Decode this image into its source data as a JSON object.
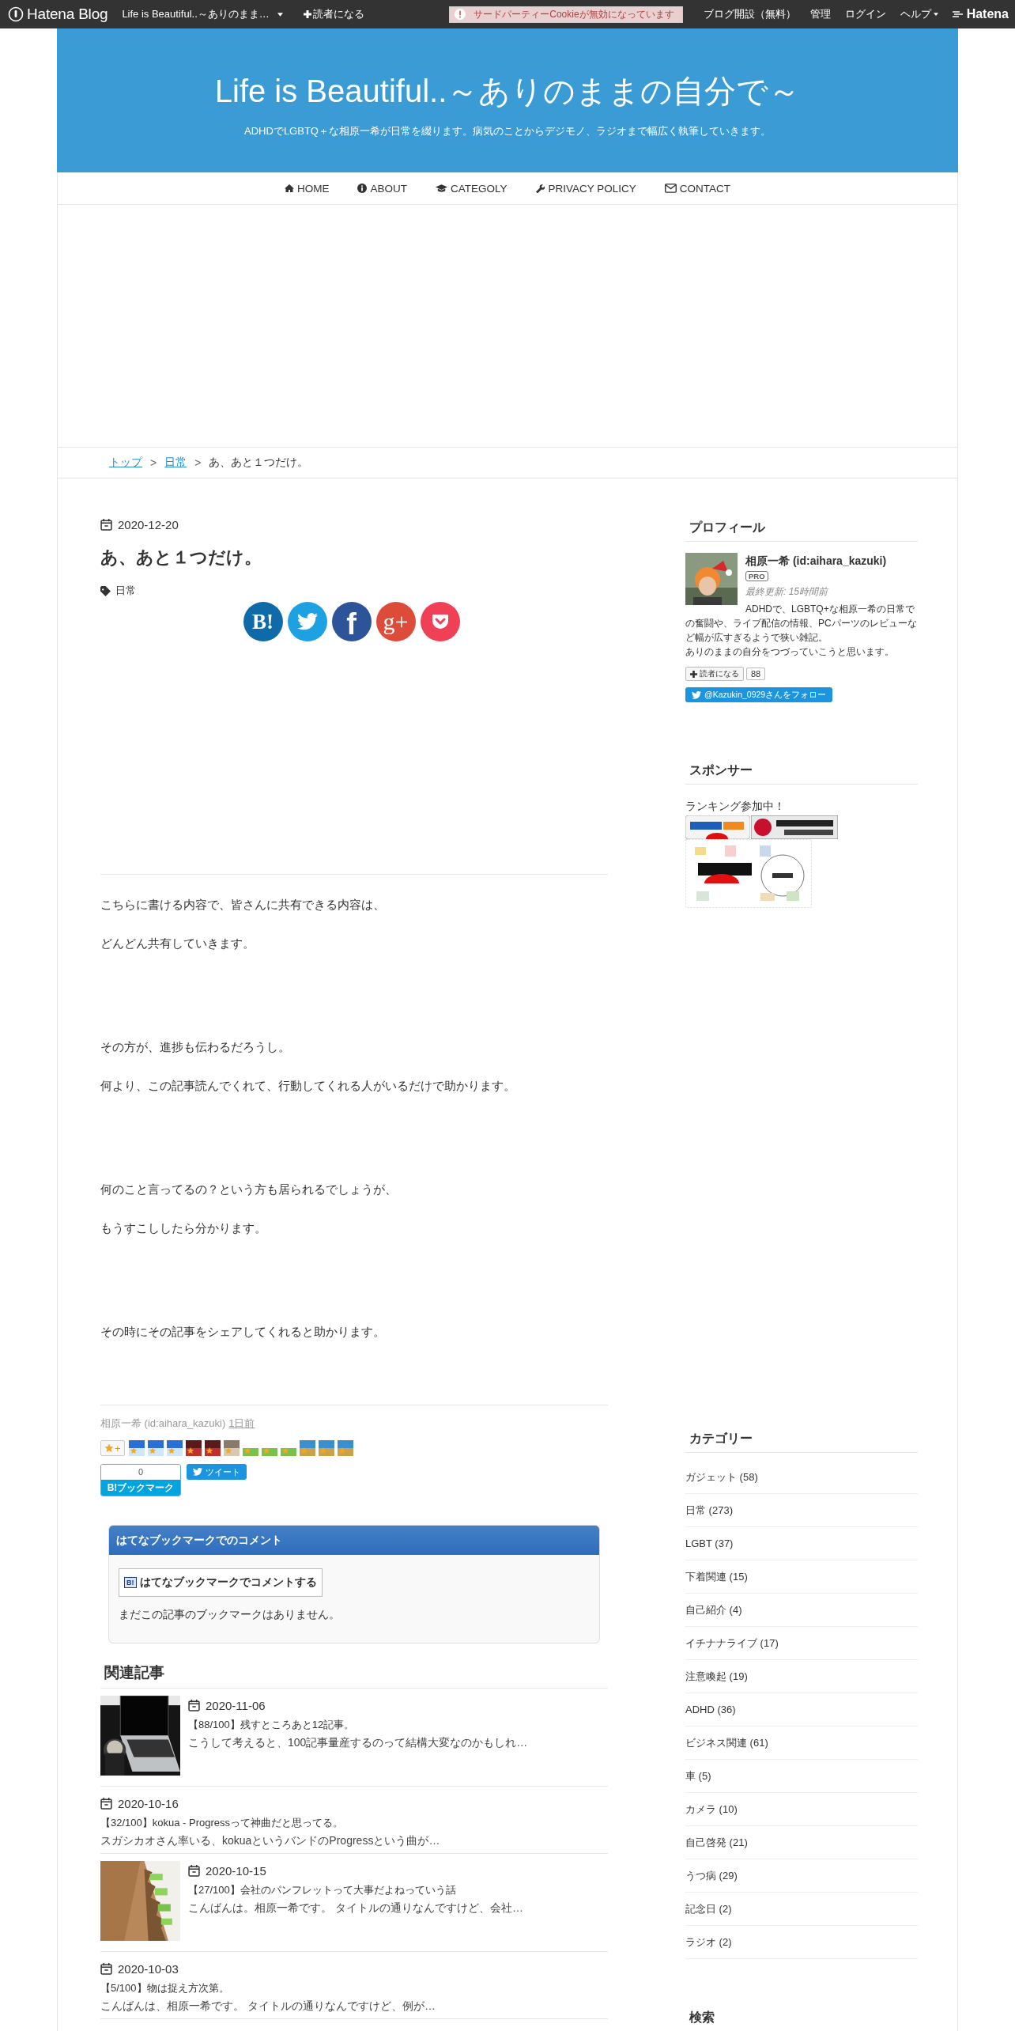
{
  "top_bar": {
    "brand": "Hatena Blog",
    "blog_menu": "Life is Beautiful..～ありのまま…",
    "subscribe": "読者になる",
    "cookie_notice": "サードパーティーCookieが無効になっています",
    "links": [
      {
        "label": "ブログ開設（無料）",
        "dropdown": false
      },
      {
        "label": "管理",
        "dropdown": false
      },
      {
        "label": "ログイン",
        "dropdown": false
      },
      {
        "label": "ヘルプ",
        "dropdown": true
      }
    ],
    "hatena": "Hatena"
  },
  "header": {
    "title": "Life is Beautiful..～ありのままの自分で～",
    "description": "ADHDでLGBTQ＋な相原一希が日常を綴ります。病気のことからデジモノ、ラジオまで幅広く執筆していきます。"
  },
  "nav": [
    {
      "kind": "home",
      "label": "HOME"
    },
    {
      "kind": "info",
      "label": "ABOUT"
    },
    {
      "kind": "cap",
      "label": "CATEGOLY"
    },
    {
      "kind": "wrench",
      "label": "PRIVACY POLICY"
    },
    {
      "kind": "mail",
      "label": "CONTACT"
    }
  ],
  "breadcrumb": {
    "items": [
      {
        "label": "トップ",
        "link": true
      },
      {
        "label": "日常",
        "link": true
      },
      {
        "label": "あ、あと１つだけ。",
        "link": false
      }
    ],
    "separators": [
      ">",
      ">"
    ]
  },
  "article": {
    "date": "2020-12-20",
    "title": "あ、あと１つだけ。",
    "tags": [
      "日常"
    ],
    "share": [
      {
        "kind": "hatena",
        "label": "B!"
      },
      {
        "kind": "twitter"
      },
      {
        "kind": "facebook",
        "label": "f"
      },
      {
        "kind": "googleplus",
        "label": "g+"
      },
      {
        "kind": "pocket"
      }
    ],
    "body": [
      [
        "こちらに書ける内容で、皆さんに共有できる内容は、",
        "どんどん共有していきます。"
      ],
      [
        "その方が、進捗も伝わるだろうし。",
        "何より、この記事読んでくれて、行動してくれる人がいるだけで助かります。"
      ],
      [
        "何のこと言ってるの？という方も居られるでしょうが、",
        "もうすこししたら分かります。"
      ],
      [
        "その時にその記事をシェアしてくれると助かります。"
      ]
    ],
    "author": "相原一希 (id:aihara_kazuki)",
    "posted": "1日前",
    "add_star": "+",
    "stars": [
      {
        "kind": "sky"
      },
      {
        "kind": "sky"
      },
      {
        "kind": "sky"
      },
      {
        "kind": "red"
      },
      {
        "kind": "red"
      },
      {
        "kind": "face"
      },
      {
        "kind": "leaf"
      },
      {
        "kind": "leaf"
      },
      {
        "kind": "leaf"
      },
      {
        "kind": "bus"
      },
      {
        "kind": "bus"
      },
      {
        "kind": "bus"
      }
    ],
    "bookmark": {
      "count": "0",
      "mark": "B!",
      "label": "ブックマーク"
    },
    "tweet": "ツイート",
    "comments": {
      "title": "はてなブックマークでのコメント",
      "mark": "B!",
      "button": "はてなブックマークでコメントする",
      "empty": "まだこの記事のブックマークはありません。"
    }
  },
  "related": {
    "title": "関連記事",
    "items": [
      {
        "thumbnail": true,
        "date": "2020-11-06",
        "title": "【88/100】残すところあと12記事。",
        "snippet": "こうして考えると、100記事量産するのって結構大変なのかもしれ…"
      },
      {
        "thumbnail": false,
        "date": "2020-10-16",
        "title": "【32/100】kokua - Progressって神曲だと思ってる。",
        "snippet": "スガシカオさん率いる、kokuaというバンドのProgressという曲が…"
      },
      {
        "thumbnail": true,
        "date": "2020-10-15",
        "title": "【27/100】会社のパンフレットって大事だよねっていう話",
        "snippet": "こんばんは。相原一希です。 タイトルの通りなんですけど、会社…"
      },
      {
        "thumbnail": false,
        "date": "2020-10-03",
        "title": "【5/100】物は捉え方次第。",
        "snippet": "こんばんは、相原一希です。 タイトルの通りなんですけど、例が…"
      }
    ]
  },
  "sidebar": {
    "profile": {
      "title": "プロフィール",
      "name": "相原一希 (id:aihara_kazuki)",
      "badge": "PRO",
      "updated": "最終更新: 15時間前",
      "description": [
        "ADHDで、LGBTQ+な相原一希の日常での奮闘や、ライブ配信の情報、PCパーツのレビューなど幅が広すぎるようで狭い雑記。",
        "ありのままの自分をつづっていこうと思います。"
      ],
      "subscribe": "読者になる",
      "subscribers": "88",
      "follow": "@Kazukin_0929さんをフォロー"
    },
    "sponsor": {
      "title": "スポンサー",
      "text": "ランキング参加中！"
    },
    "categories": {
      "title": "カテゴリー",
      "items": [
        "ガジェット (58)",
        "日常 (273)",
        "LGBT (37)",
        "下着関連 (15)",
        "自己紹介 (4)",
        "イチナナライブ (17)",
        "注意喚起 (19)",
        "ADHD (36)",
        "ビジネス関連 (61)",
        "車 (5)",
        "カメラ (10)",
        "自己啓発 (21)",
        "うつ病 (29)",
        "記念日 (2)",
        "ラジオ (2)"
      ]
    },
    "search": {
      "title": "検索"
    }
  }
}
